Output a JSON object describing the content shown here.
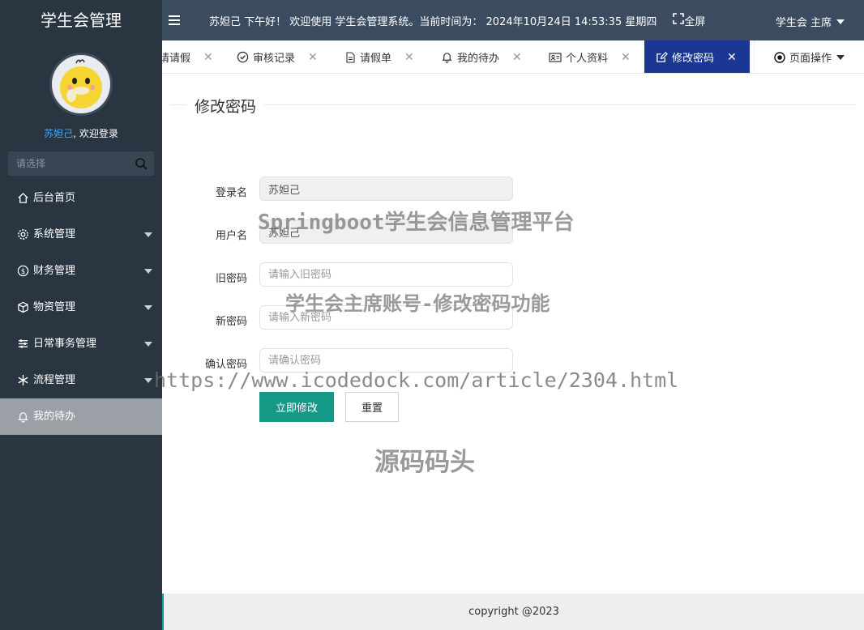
{
  "sidebar": {
    "brand": "学生会管理",
    "user_name": "苏妲己",
    "welcome_suffix": ", 欢迎登录",
    "search_placeholder": "请选择",
    "items": [
      {
        "label": "后台首页",
        "icon": "home-icon"
      },
      {
        "label": "系统管理",
        "icon": "gear-icon"
      },
      {
        "label": "财务管理",
        "icon": "dollar-icon"
      },
      {
        "label": "物资管理",
        "icon": "box-icon"
      },
      {
        "label": "日常事务管理",
        "icon": "sliders-icon"
      },
      {
        "label": "流程管理",
        "icon": "snowflake-icon"
      },
      {
        "label": "我的待办",
        "icon": "bell-icon"
      }
    ]
  },
  "header": {
    "greeting": "苏妲己 下午好！ 欢迎使用 学生会管理系统。当前时间为： 2024年10月24日 14:53:35   星期四",
    "fullscreen": "全屏",
    "user_role": "学生会 主席"
  },
  "tabs": [
    {
      "label": "请请假"
    },
    {
      "label": "审核记录",
      "icon": "check-circle-icon"
    },
    {
      "label": "请假单",
      "icon": "document-icon"
    },
    {
      "label": "我的待办",
      "icon": "bell-icon"
    },
    {
      "label": "个人资料",
      "icon": "id-card-icon"
    },
    {
      "label": "修改密码",
      "icon": "edit-icon"
    }
  ],
  "page_ops": "页面操作",
  "form": {
    "title": "修改密码",
    "login_name_label": "登录名",
    "login_name_value": "苏妲己",
    "user_name_label": "用户名",
    "user_name_value": "苏妲己",
    "old_pw_label": "旧密码",
    "old_pw_placeholder": "请输入旧密码",
    "new_pw_label": "新密码",
    "new_pw_placeholder": "请输入新密码",
    "confirm_pw_label": "确认密码",
    "confirm_pw_placeholder": "请确认密码",
    "submit_label": "立即修改",
    "reset_label": "重置"
  },
  "watermarks": {
    "line1": "Springboot学生会信息管理平台",
    "line2": "学生会主席账号-修改密码功能",
    "line3": "https://www.icodedock.com/article/2304.html",
    "line4": "源码码头"
  },
  "footer": "copyright @2023"
}
